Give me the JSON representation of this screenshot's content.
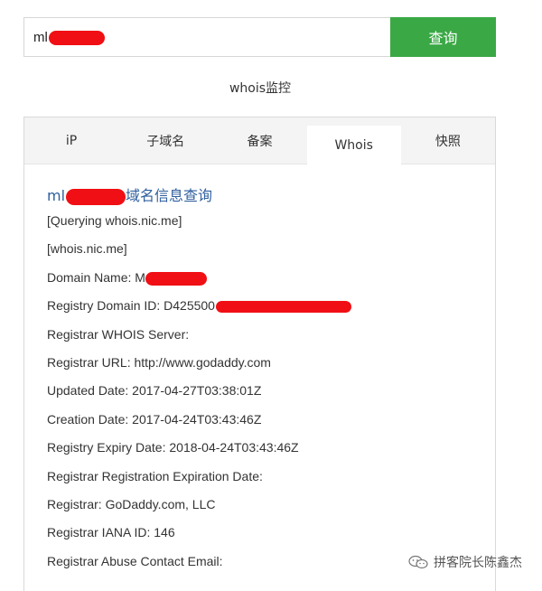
{
  "search": {
    "value": "ml",
    "button_label": "查询"
  },
  "monitor_link": "whois监控",
  "tabs": [
    {
      "label": "iP",
      "active": false
    },
    {
      "label": "子域名",
      "active": false
    },
    {
      "label": "备案",
      "active": false
    },
    {
      "label": "Whois",
      "active": true
    },
    {
      "label": "快照",
      "active": false
    }
  ],
  "result": {
    "title_prefix": "ml",
    "title_suffix": "域名信息查询",
    "lines": {
      "querying": "[Querying whois.nic.me]",
      "server": "[whois.nic.me]",
      "domain_name": "Domain Name: M",
      "registry_domain_id": "Registry Domain ID: D425500",
      "whois_server": "Registrar WHOIS Server:",
      "registrar_url": "Registrar URL: http://www.godaddy.com",
      "updated_date": "Updated Date: 2017-04-27T03:38:01Z",
      "creation_date": "Creation Date: 2017-04-24T03:43:46Z",
      "expiry_date": "Registry Expiry Date: 2018-04-24T03:43:46Z",
      "registration_expiration": "Registrar Registration Expiration Date:",
      "registrar": "Registrar: GoDaddy.com, LLC",
      "iana_id": "Registrar IANA ID: 146",
      "abuse_email": "Registrar Abuse Contact Email:"
    }
  },
  "watermark": {
    "text": "拼客院长陈鑫杰",
    "icon": "wechat-icon"
  },
  "colors": {
    "button": "#3aa845",
    "title": "#2f5f9e",
    "redaction": "#f00f14"
  }
}
